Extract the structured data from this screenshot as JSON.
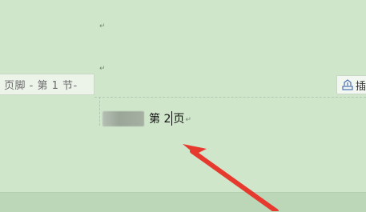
{
  "document": {
    "paragraph_mark": "↵",
    "footer_label": "页脚 - 第 1 节-",
    "footer_button_label": "插",
    "footer_text": {
      "before": "第 2",
      "after": "页"
    }
  },
  "colors": {
    "page_background": "#cfe6cb",
    "annotation_arrow": "#e53a2d"
  },
  "icons": {
    "footer_button": "insert-page-number-icon"
  }
}
